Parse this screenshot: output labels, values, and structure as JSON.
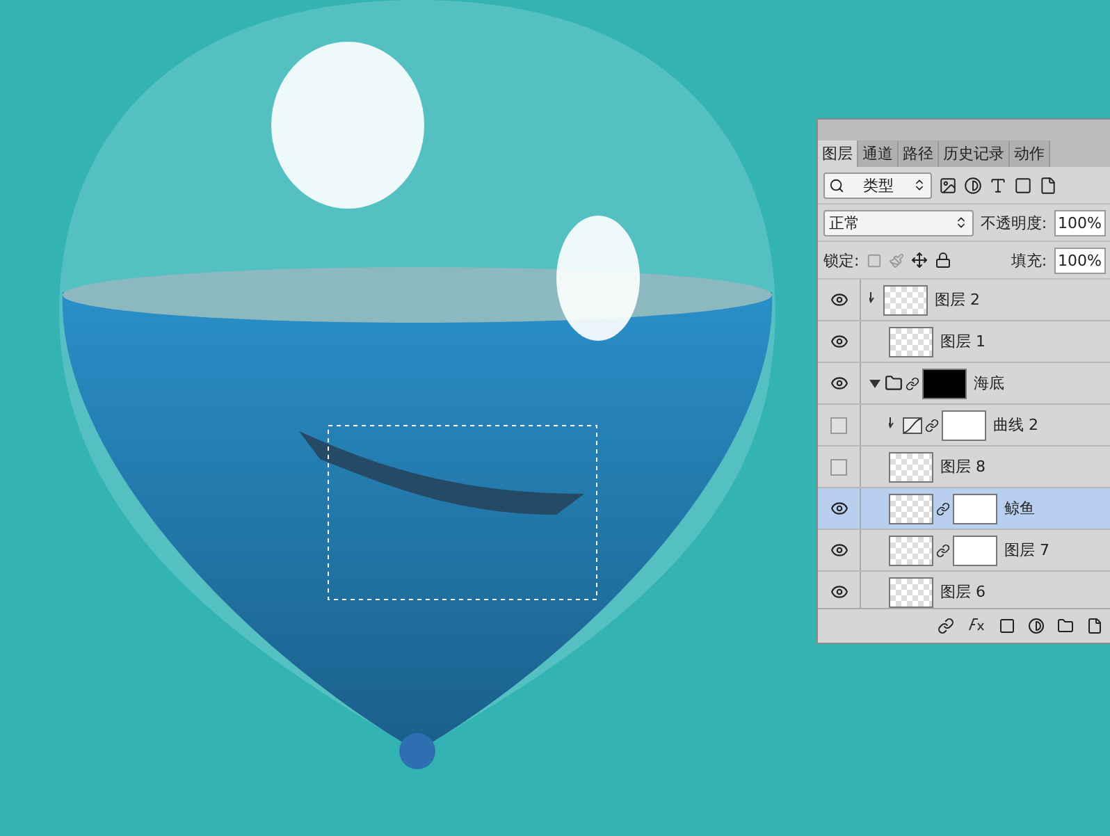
{
  "panel": {
    "tabs": [
      {
        "label": "图层",
        "selected": true
      },
      {
        "label": "通道",
        "selected": false
      },
      {
        "label": "路径",
        "selected": false
      },
      {
        "label": "历史记录",
        "selected": false
      },
      {
        "label": "动作",
        "selected": false
      }
    ],
    "filter": {
      "value": "类型"
    },
    "blend": {
      "value": "正常",
      "opacity_label": "不透明度:",
      "opacity": "100%"
    },
    "lock": {
      "label": "锁定:",
      "fill_label": "填充:",
      "fill": "100%"
    },
    "layers": [
      {
        "name": "图层 2",
        "kind": "layer",
        "visible": true,
        "selected": false,
        "mask": false,
        "clipped": true
      },
      {
        "name": "图层 1",
        "kind": "layer",
        "visible": true,
        "selected": false,
        "mask": false,
        "clipped": false
      },
      {
        "name": "海底",
        "kind": "group",
        "visible": true,
        "selected": false,
        "mask": true,
        "clipped": false,
        "expanded": true
      },
      {
        "name": "曲线 2",
        "kind": "curves",
        "visible": false,
        "selected": false,
        "mask": true,
        "clipped": true
      },
      {
        "name": "图层 8",
        "kind": "layer",
        "visible": false,
        "selected": false,
        "mask": false,
        "clipped": false
      },
      {
        "name": "鲸鱼",
        "kind": "smart",
        "visible": true,
        "selected": true,
        "mask": true,
        "clipped": false
      },
      {
        "name": "图层 7",
        "kind": "smart",
        "visible": true,
        "selected": false,
        "mask": true,
        "clipped": false
      },
      {
        "name": "图层 6",
        "kind": "smart",
        "visible": true,
        "selected": false,
        "mask": false,
        "clipped": false
      }
    ]
  }
}
